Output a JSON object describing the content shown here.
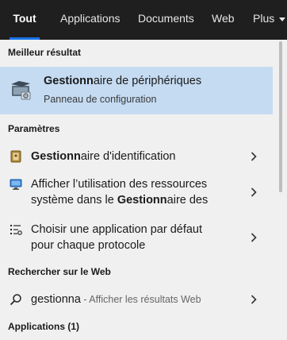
{
  "tabs": {
    "all": "Tout",
    "apps": "Applications",
    "documents": "Documents",
    "web": "Web",
    "more": "Plus"
  },
  "best_match": {
    "header": "Meilleur résultat",
    "title_bold": "Gestionn",
    "title_rest": "aire de périphériques",
    "subtitle": "Panneau de configuration",
    "icon": "device-manager-icon"
  },
  "settings": {
    "header": "Paramètres",
    "items": [
      {
        "bold": "Gestionn",
        "rest": "aire d'identification",
        "icon": "credential-manager-icon"
      },
      {
        "line1": "Afficher l’utilisation des ressources",
        "line2_pre": "système dans le ",
        "line2_bold": "Gestionn",
        "line2_rest": "aire des",
        "icon": "monitor-icon"
      },
      {
        "line1": "Choisir une application par défaut",
        "line2": "pour chaque protocole",
        "icon": "list-settings-icon"
      }
    ]
  },
  "web": {
    "header": "Rechercher sur le Web",
    "query": "gestionna",
    "hint": " - Afficher les résultats Web",
    "icon": "search-icon"
  },
  "apps_section": {
    "header": "Applications (1)"
  },
  "colors": {
    "tabbar_bg": "#1f1f1f",
    "accent": "#1a73e8",
    "selection_bg": "#c5dbf2",
    "panel_bg": "#f0f0f0"
  }
}
